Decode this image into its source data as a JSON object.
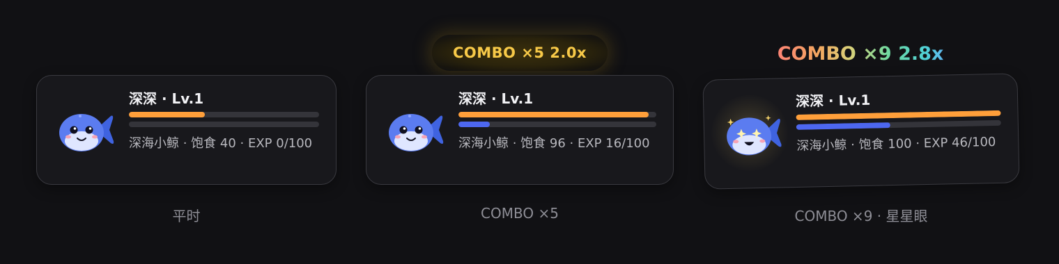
{
  "colors": {
    "background": "#111114",
    "card": "#18181c",
    "feed_bar": "#ff9f3a",
    "exp_bar": "#4d67f0",
    "combo_gold": "#f7c948"
  },
  "cards": [
    {
      "name": "深深 · Lv.1",
      "desc": "深海小鲸 · 饱食 40 · EXP 0/100",
      "feed_fraction": 0.4,
      "exp_fraction": 0.0,
      "caption": "平时",
      "avatar": "whale-normal-icon"
    },
    {
      "name": "深深 · Lv.1",
      "desc": "深海小鲸 · 饱食 96 · EXP 16/100",
      "feed_fraction": 0.96,
      "exp_fraction": 0.16,
      "caption": "COMBO ×5",
      "combo_badge": "COMBO ×5 2.0x",
      "avatar": "whale-normal-icon"
    },
    {
      "name": "深深 · Lv.1",
      "desc": "深海小鲸 · 饱食 100 · EXP 46/100",
      "feed_fraction": 1.0,
      "exp_fraction": 0.46,
      "caption": "COMBO ×9 · 星星眼",
      "combo_badge": "COMBO ×9 2.8x",
      "avatar": "whale-star-eyes-icon"
    }
  ]
}
